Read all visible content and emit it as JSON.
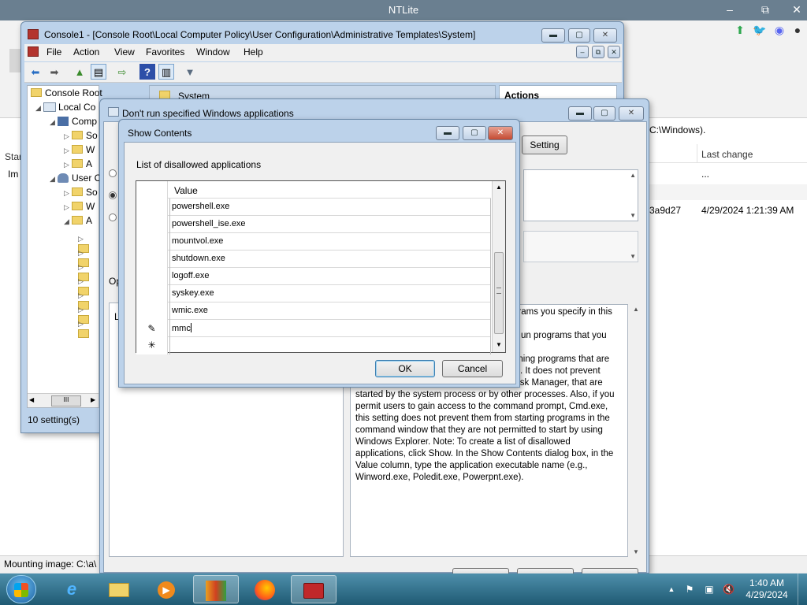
{
  "ntlite": {
    "title": "NTLite",
    "controls": {
      "minimize": "–",
      "restore": "⧉",
      "close": "✕"
    },
    "path_fragment": "C:\\Windows).",
    "columns": {
      "start": "Star",
      "image": "Im",
      "last_change": "Last change"
    },
    "row_ellipsis": "...",
    "row_hash": "3a9d27",
    "row_date": "4/29/2024 1:21:39 AM",
    "status": "Mounting image: C:\\a\\",
    "side_icons": {
      "up": "⬆",
      "twitter": "🐦",
      "discord": "◉",
      "github": "●"
    }
  },
  "console1": {
    "title": "Console1 - [Console Root\\Local Computer Policy\\User Configuration\\Administrative Templates\\System]",
    "menu": [
      "File",
      "Action",
      "View",
      "Favorites",
      "Window",
      "Help"
    ],
    "tree": {
      "root": "Console Root",
      "local": "Local Co",
      "comp": "Comp",
      "comp_children": [
        "So",
        "W",
        "A"
      ],
      "user": "User C",
      "user_children": [
        "So",
        "W",
        "A"
      ]
    },
    "center_header": "System",
    "actions_header": "Actions",
    "scroll_thumb": "III",
    "status": "10 setting(s)"
  },
  "policy": {
    "title": "Don't run specified Windows applications",
    "setting_button": "Setting",
    "options_label": "Op",
    "left_box_label": "Li",
    "help_text": [
      "grams you specify in this",
      "",
      "un programs that you",
      "",
      "aning programs that are",
      "started by the Windows Explorer process. It does not prevent",
      "users from running programs, such as Task Manager, that are",
      "started by the system process or by other processes. Also, if you",
      "permit users to gain access to the command prompt, Cmd.exe,",
      "this setting does not prevent them from starting programs in the",
      "command window that they are not permitted to start by using",
      "Windows Explorer. Note: To create a list of disallowed",
      "applications, click Show. In the Show Contents dialog box, in the",
      "Value column, type the application executable name (e.g.,",
      "Winword.exe, Poledit.exe, Powerpnt.exe)."
    ]
  },
  "show_contents": {
    "title": "Show Contents",
    "label": "List of disallowed applications",
    "column_value": "Value",
    "rows": [
      "powershell.exe",
      "powershell_ise.exe",
      "mountvol.exe",
      "shutdown.exe",
      "logoff.exe",
      "syskey.exe",
      "wmic.exe"
    ],
    "editing_value": "mmc",
    "editing_marker": "✎",
    "new_row_marker": "✳",
    "ok": "OK",
    "cancel": "Cancel"
  },
  "taskbar": {
    "time": "1:40 AM",
    "date": "4/29/2024",
    "apps": [
      "ie-icon",
      "explorer-icon",
      "media-player-icon",
      "ntlite-icon",
      "firefox-icon",
      "toolbox-icon"
    ]
  }
}
